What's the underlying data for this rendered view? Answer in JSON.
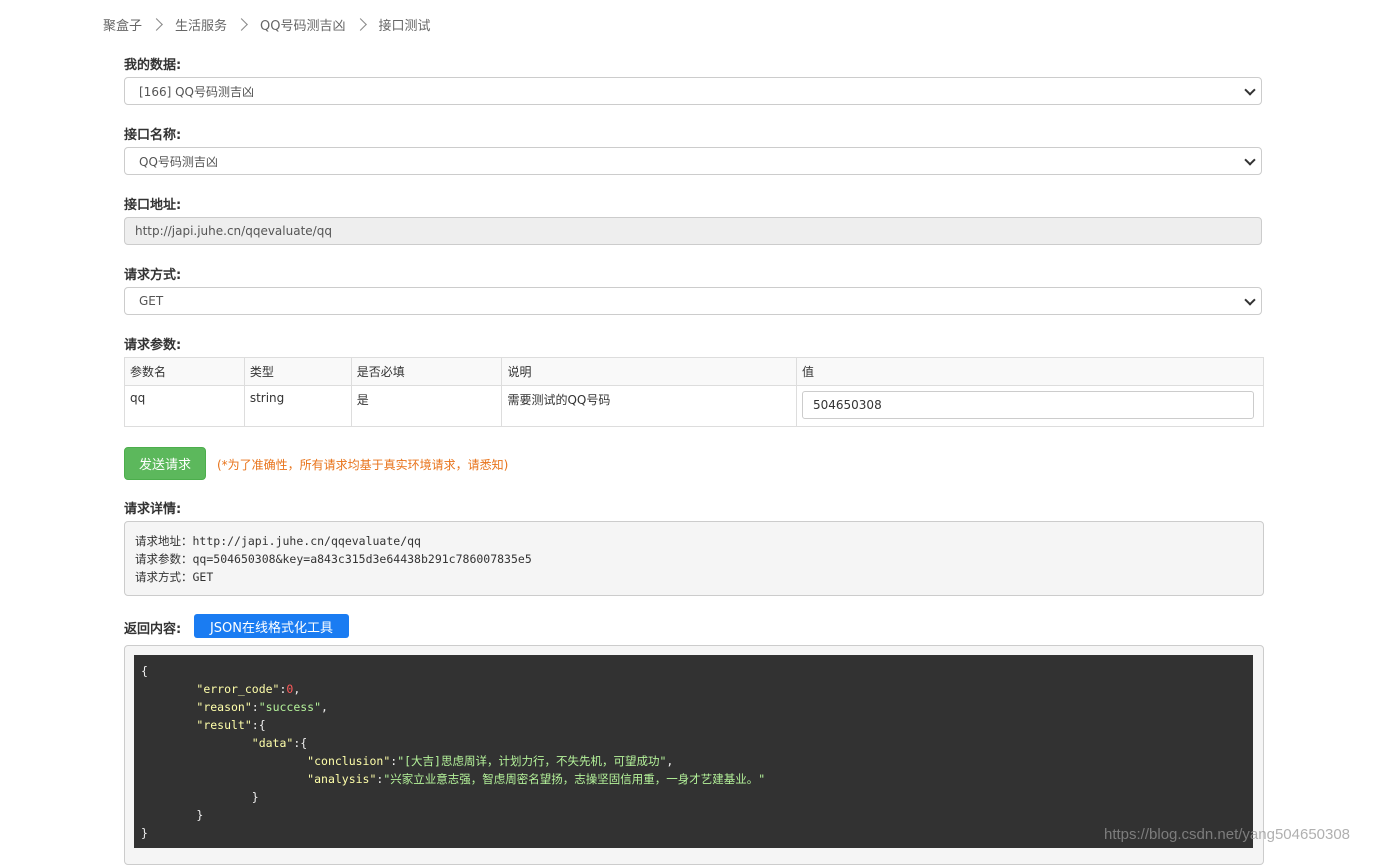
{
  "breadcrumb": [
    "聚盒子",
    "生活服务",
    "QQ号码测吉凶",
    "接口测试"
  ],
  "form": {
    "my_data_label": "我的数据:",
    "my_data_value": "[166] QQ号码测吉凶",
    "api_name_label": "接口名称:",
    "api_name_value": "QQ号码测吉凶",
    "api_url_label": "接口地址:",
    "api_url_value": "http://japi.juhe.cn/qqevaluate/qq",
    "method_label": "请求方式:",
    "method_value": "GET",
    "params_label": "请求参数:"
  },
  "params_table": {
    "headers": [
      "参数名",
      "类型",
      "是否必填",
      "说明",
      "值"
    ],
    "rows": [
      {
        "name": "qq",
        "type": "string",
        "required": "是",
        "desc": "需要测试的QQ号码",
        "value": "504650308"
      }
    ]
  },
  "send": {
    "button_label": "发送请求",
    "note": "(*为了准确性，所有请求均基于真实环境请求，请悉知)"
  },
  "detail": {
    "label": "请求详情:",
    "lines": [
      "请求地址：http://japi.juhe.cn/qqevaluate/qq",
      "请求参数：qq=504650308&key=a843c315d3e64438b291c786007835e5",
      "请求方式：GET"
    ]
  },
  "response": {
    "label": "返回内容:",
    "json_tool_button": "JSON在线格式化工具",
    "open_brace": "{",
    "error_code_key": "\"error_code\"",
    "error_code_val": "0",
    "reason_key": "\"reason\"",
    "reason_val": "\"success\"",
    "result_key": "\"result\"",
    "data_key": "\"data\"",
    "conclusion_key": "\"conclusion\"",
    "conclusion_val": "\"[大吉]思虑周详，计划力行，不失先机，可望成功\"",
    "analysis_key": "\"analysis\"",
    "analysis_val": "\"兴家立业意志强，智虑周密名望扬，志操坚固信用重，一身才艺建基业。\"",
    "close_brace": "}"
  },
  "watermark": "https://blog.csdn.net/yang504650308"
}
